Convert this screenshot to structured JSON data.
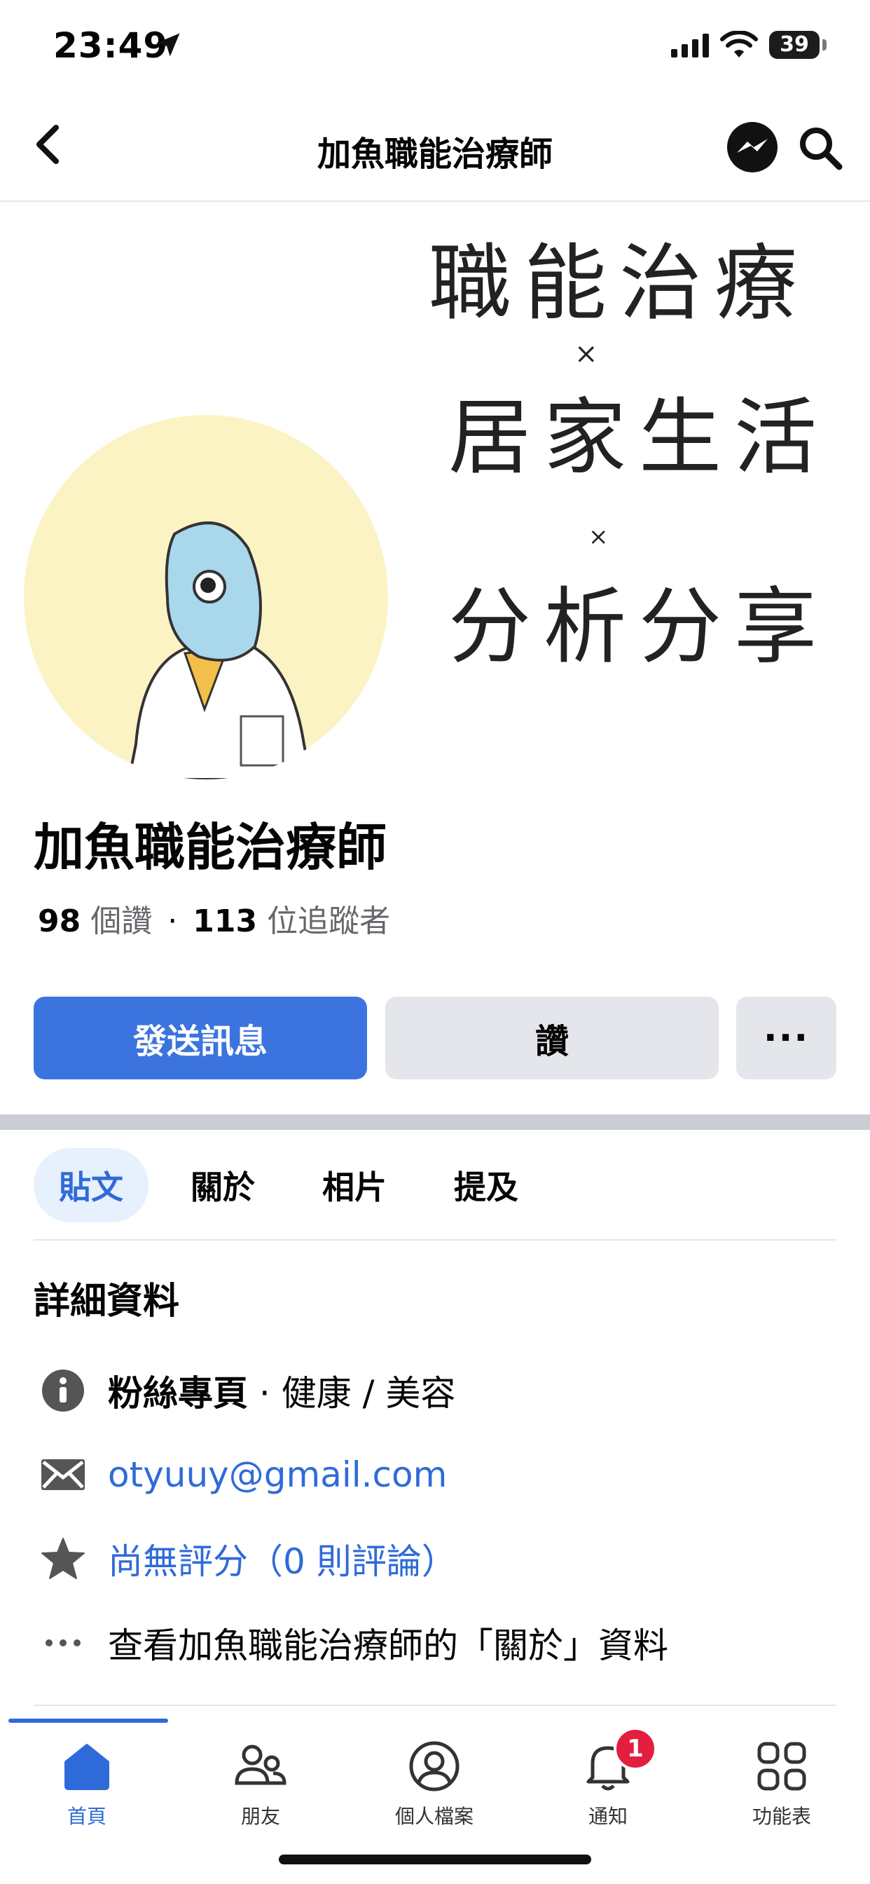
{
  "status_bar": {
    "time": "23:49",
    "battery": "39"
  },
  "header": {
    "title": "加魚職能治療師"
  },
  "cover": {
    "line1": "職能治療",
    "line2": "居家生活",
    "line3": "分析分享",
    "sep": "×"
  },
  "page": {
    "name": "加魚職能治療師",
    "likes_count": "98",
    "likes_label": "個讚",
    "dot": "·",
    "followers_count": "113",
    "followers_label": "位追蹤者"
  },
  "actions": {
    "message": "發送訊息",
    "like": "讚",
    "more": "···"
  },
  "tabs": [
    {
      "label": "貼文",
      "active": true
    },
    {
      "label": "關於",
      "active": false
    },
    {
      "label": "相片",
      "active": false
    },
    {
      "label": "提及",
      "active": false
    }
  ],
  "details": {
    "title": "詳細資料",
    "category_type": "粉絲專頁",
    "category_sep": " · ",
    "category": "健康 / 美容",
    "email": "otyuuy@gmail.com",
    "rating": "尚無評分（0 則評論）",
    "about": "查看加魚職能治療師的「關於」資料"
  },
  "bottom_nav": [
    {
      "label": "首頁",
      "icon": "home-icon",
      "active": true
    },
    {
      "label": "朋友",
      "icon": "friends-icon",
      "active": false
    },
    {
      "label": "個人檔案",
      "icon": "profile-icon",
      "active": false
    },
    {
      "label": "通知",
      "icon": "bell-icon",
      "active": false,
      "badge": "1"
    },
    {
      "label": "功能表",
      "icon": "menu-grid-icon",
      "active": false
    }
  ],
  "colors": {
    "primary": "#3b74de",
    "link": "#2f6bd8",
    "badge": "#e41e3f"
  }
}
